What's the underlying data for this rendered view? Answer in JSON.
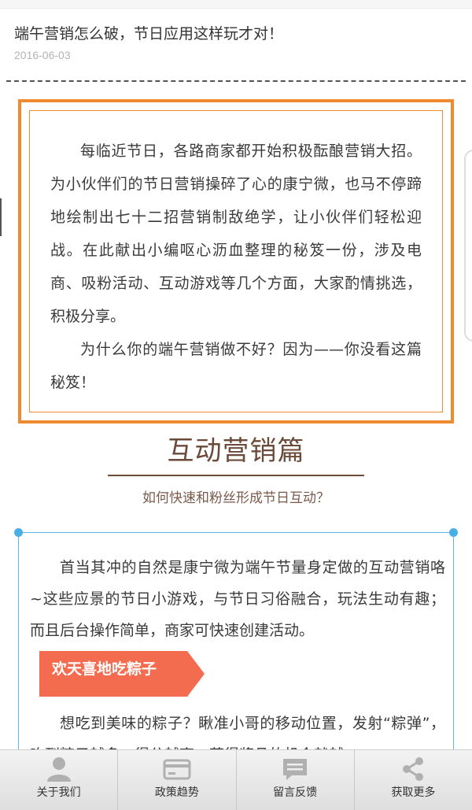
{
  "article": {
    "title": "端午营销怎么破，节日应用这样玩才对！",
    "date": "2016-06-03"
  },
  "intro": {
    "para1": "每临近节日，各路商家都开始积极酝酿营销大招。为小伙伴们的节日营销操碎了心的康宁微，也马不停蹄地绘制出七十二招营销制敌绝学，让小伙伴们轻松迎战。在此献出小编呕心沥血整理的秘笈一份，涉及电商、吸粉活动、互动游戏等几个方面，大家酌情挑选，积极分享。",
    "para2": "为什么你的端午营销做不好？因为——你没看这篇秘笈！"
  },
  "section": {
    "title": "互动营销篇",
    "subtitle": "如何快速和粉丝形成节日互动？"
  },
  "content": {
    "para1": "首当其冲的自然是康宁微为端午节量身定做的互动营销咯~这些应景的节日小游戏，与节日习俗融合，玩法生动有趣；而且后台操作简单，商家可快速创建活动。",
    "tag": "欢天喜地吃粽子",
    "para2": "想吃到美味的粽子？瞅准小哥的移动位置，发射“粽弹”，吃到粽子越多，得分越高，获得奖品的机会就越"
  },
  "nav": {
    "items": [
      {
        "label": "关于我们",
        "icon": "user-icon"
      },
      {
        "label": "政策趋势",
        "icon": "card-icon"
      },
      {
        "label": "留言反馈",
        "icon": "message-icon"
      },
      {
        "label": "获取更多",
        "icon": "share-icon"
      }
    ]
  },
  "colors": {
    "orange_border": "#f08a2e",
    "section_brown": "#6b4a3a",
    "blue_border": "#5bb8e6",
    "tag_red": "#f36c4f"
  }
}
